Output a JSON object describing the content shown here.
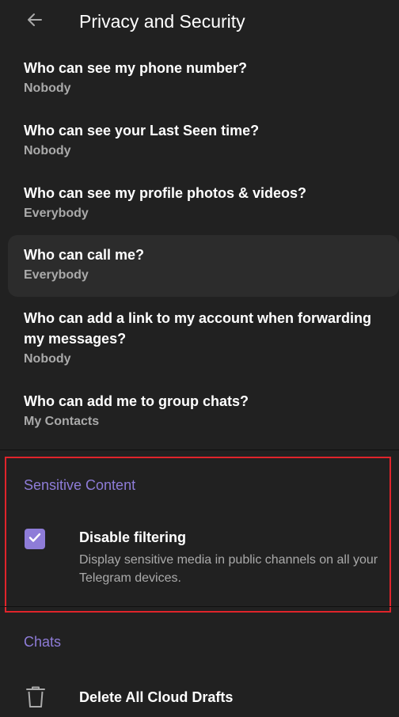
{
  "header": {
    "title": "Privacy and Security"
  },
  "privacy": {
    "items": [
      {
        "title": "Who can see my phone number?",
        "value": "Nobody"
      },
      {
        "title": "Who can see your Last Seen time?",
        "value": "Nobody"
      },
      {
        "title": "Who can see my profile photos & videos?",
        "value": "Everybody"
      },
      {
        "title": "Who can call me?",
        "value": "Everybody"
      },
      {
        "title": "Who can add a link to my account when forwarding my messages?",
        "value": "Nobody"
      },
      {
        "title": "Who can add me to group chats?",
        "value": "My Contacts"
      }
    ]
  },
  "sensitive": {
    "header": "Sensitive Content",
    "checkbox_label": "Disable filtering",
    "checkbox_description": "Display sensitive media in public channels on all your Telegram devices.",
    "checked": true
  },
  "chats": {
    "header": "Chats",
    "delete_drafts_label": "Delete All Cloud Drafts"
  },
  "colors": {
    "accent": "#8e7cd8",
    "background": "#212121",
    "highlight_border": "#e0242b"
  }
}
